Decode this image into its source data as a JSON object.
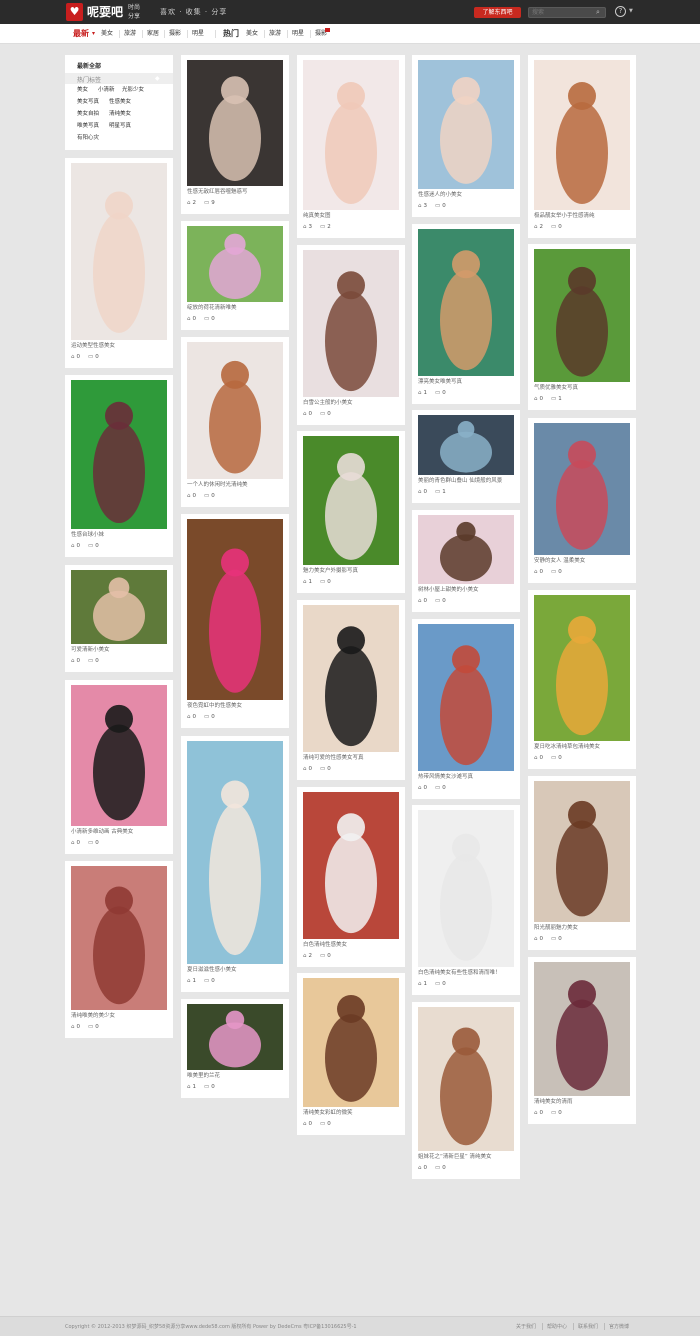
{
  "header": {
    "logo_icon": "heart-logo-icon",
    "logo_text": "呢耍吧",
    "logo_sub": "时尚分享",
    "slogan": "喜欢 · 收集 · 分享",
    "join_label": "了解东西吧",
    "search_placeholder": "搜索",
    "accent": "#c81e1e"
  },
  "nav": {
    "latest": "最新",
    "latest_items": [
      "美女",
      "旅游",
      "家居",
      "摄影",
      "明星"
    ],
    "hot": "热门",
    "hot_items": [
      "美女",
      "旅游",
      "明星",
      "摄影"
    ]
  },
  "sidebar": {
    "title": "最新全部",
    "hot": "热门标签",
    "links": [
      "美女",
      "小清新",
      "光影少女",
      "美女写真",
      "性感美女",
      "美女自拍",
      "清纯美女",
      "唯美写真",
      "明星写真",
      "有阳心灾"
    ]
  },
  "cards": [
    {
      "caption": "运动美型性感美女",
      "likes": "0",
      "comments": "0",
      "bg": "#ece6e3",
      "fg": "#f0d5c8"
    },
    {
      "caption": "性感台球小妹",
      "likes": "0",
      "comments": "0",
      "bg": "#2f9a3a",
      "fg": "#6a2e3a"
    },
    {
      "caption": "可爱清新小美女",
      "likes": "0",
      "comments": "0",
      "bg": "#5f7a3a",
      "fg": "#e3bfa7"
    },
    {
      "caption": "小清新多维动画 古典美女",
      "likes": "0",
      "comments": "0",
      "bg": "#e48aa8",
      "fg": "#1a1a1a"
    },
    {
      "caption": "清纯唯美的美少女",
      "likes": "0",
      "comments": "0",
      "bg": "#c97d78",
      "fg": "#8f3a33"
    },
    {
      "caption": "性感无敌红唇吞噬魅惑写",
      "likes": "2",
      "comments": "9",
      "bg": "#3a3533",
      "fg": "#d8c1b2"
    },
    {
      "caption": "绽放的荷花清新唯美",
      "likes": "0",
      "comments": "0",
      "bg": "#7cb35a",
      "fg": "#e3a6d6"
    },
    {
      "caption": "一个人的休闲时光清纯美",
      "likes": "0",
      "comments": "0",
      "bg": "#ece5e2",
      "fg": "#b7683e"
    },
    {
      "caption": "夜色霓虹中的性感美女",
      "likes": "0",
      "comments": "0",
      "bg": "#7a4a2a",
      "fg": "#e8327a"
    },
    {
      "caption": "夏日滋滋性感小美女",
      "likes": "1",
      "comments": "0",
      "bg": "#8fc2d8",
      "fg": "#f2e6dc"
    },
    {
      "caption": "唯美里的兰花",
      "likes": "1",
      "comments": "0",
      "bg": "#3a4a2a",
      "fg": "#e696c8"
    },
    {
      "caption": "纯真美女图",
      "likes": "3",
      "comments": "2",
      "bg": "#f2e8e8",
      "fg": "#f0c9b8"
    },
    {
      "caption": "白雪公主般的小美女",
      "likes": "0",
      "comments": "0",
      "bg": "#e9dfe0",
      "fg": "#7a4a3a"
    },
    {
      "caption": "魅力美女户外摄影写真",
      "likes": "1",
      "comments": "0",
      "bg": "#4a8a2a",
      "fg": "#e8dcd7"
    },
    {
      "caption": "清纯可爱的性感美女写真",
      "likes": "0",
      "comments": "0",
      "bg": "#e9d8c8",
      "fg": "#1a1a1a"
    },
    {
      "caption": "白色清纯性感美女",
      "likes": "2",
      "comments": "0",
      "bg": "#b9473a",
      "fg": "#f2f2f2"
    },
    {
      "caption": "清纯美女彩虹的微笑",
      "likes": "0",
      "comments": "0",
      "bg": "#e8c89a",
      "fg": "#6a3a24"
    },
    {
      "caption": "性感迷人的小美女",
      "likes": "3",
      "comments": "0",
      "bg": "#9fc2da",
      "fg": "#efd3c3"
    },
    {
      "caption": "漂亮美女唯美写真",
      "likes": "1",
      "comments": "0",
      "bg": "#3b8a6a",
      "fg": "#d39a6a"
    },
    {
      "caption": "美丽的青色群山叠山 仙境般的风景",
      "likes": "0",
      "comments": "1",
      "bg": "#3a4a5a",
      "fg": "#8ab0c8"
    },
    {
      "caption": "树林小屋上甜美的小美女",
      "likes": "0",
      "comments": "0",
      "bg": "#e8d0d8",
      "fg": "#5a3a2a"
    },
    {
      "caption": "热带风情美女沙滩写真",
      "likes": "0",
      "comments": "0",
      "bg": "#6a9ac8",
      "fg": "#c24a3a"
    },
    {
      "caption": "白色清纯美女有些性感和清而唯！",
      "likes": "1",
      "comments": "0",
      "bg": "#efefef",
      "fg": "#e8e8e8"
    },
    {
      "caption": "姐妹花之“清新巨星” 清纯美女",
      "likes": "0",
      "comments": "0",
      "bg": "#e8dcd0",
      "fg": "#9a5a3a"
    },
    {
      "caption": "极品靓女举小手性感清纯",
      "likes": "2",
      "comments": "0",
      "bg": "#f2e4dc",
      "fg": "#b86a3e"
    },
    {
      "caption": "气质优雅美女写真",
      "likes": "0",
      "comments": "1",
      "bg": "#5a9a3a",
      "fg": "#5a3a2a"
    },
    {
      "caption": "安静的女人 温柔美女",
      "likes": "0",
      "comments": "0",
      "bg": "#6a8aa8",
      "fg": "#c84a5a"
    },
    {
      "caption": "夏日吃冰清纯草包清纯美女",
      "likes": "0",
      "comments": "0",
      "bg": "#7aa83a",
      "fg": "#e8a83a"
    },
    {
      "caption": "阳光靓丽魅力美女",
      "likes": "0",
      "comments": "0",
      "bg": "#d8c8b8",
      "fg": "#6a3a24"
    },
    {
      "caption": "清纯美女的清雨",
      "likes": "0",
      "comments": "0",
      "bg": "#c8c0b8",
      "fg": "#6a2a3a"
    }
  ],
  "footer": {
    "copyright": "Copyright © 2012-2013 织梦源码_织梦58资源分享www.dede58.com 版权所有 Power by DedeCms 粤ICP备13016625号-1",
    "links": [
      "关于我们",
      "帮助中心",
      "联系我们",
      "官方微博"
    ]
  }
}
